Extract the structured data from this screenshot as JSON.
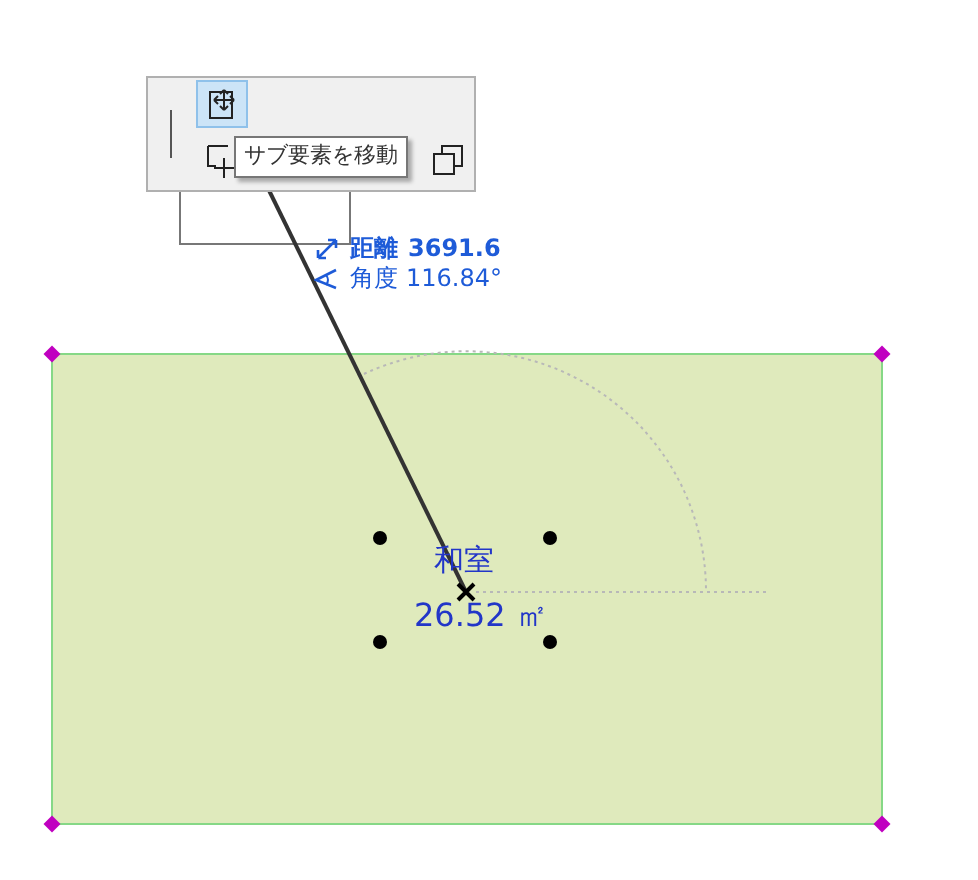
{
  "toolbar": {
    "buttons": [
      {
        "kind": "move",
        "selected": true
      },
      {
        "kind": "move-sub",
        "selected": false
      },
      {
        "kind": "copy",
        "selected": false
      }
    ]
  },
  "tooltip": "サブ要素を移動",
  "measure": {
    "distance_label": "距離",
    "distance": "3691.6",
    "angle_label": "角度",
    "angle": "116.84°"
  },
  "room": {
    "name": "和室",
    "area": "26.52 ㎡"
  }
}
